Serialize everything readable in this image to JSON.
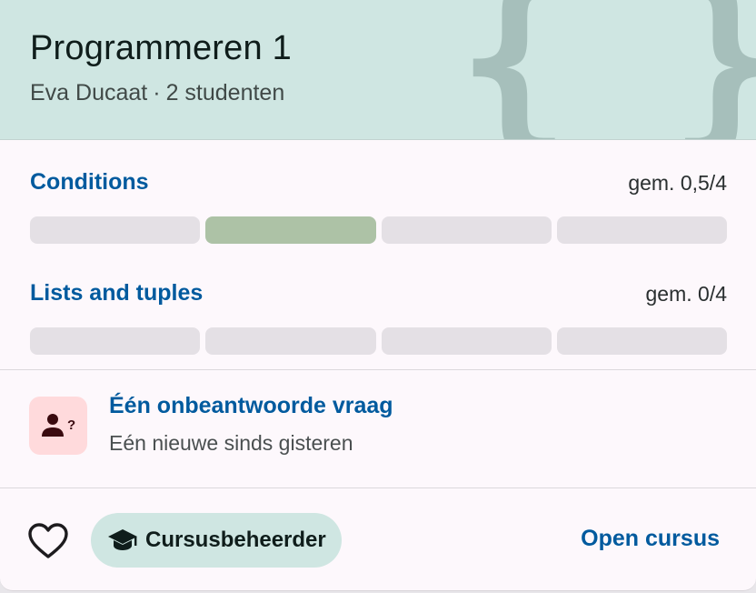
{
  "course": {
    "title": "Programmeren 1",
    "teacher": "Eva Ducaat",
    "separator": "·",
    "students": "2 studenten",
    "decoration": "{ }"
  },
  "exercises": [
    {
      "name": "Conditions",
      "score": "gem. 0,5/4",
      "bars": [
        {
          "state": "empty",
          "color": "#e4e0e5"
        },
        {
          "state": "partial",
          "color": "#adc2a6"
        },
        {
          "state": "empty",
          "color": "#e4e0e5"
        },
        {
          "state": "empty",
          "color": "#e4e0e5"
        }
      ]
    },
    {
      "name": "Lists and tuples",
      "score": "gem. 0/4",
      "bars": [
        {
          "state": "empty",
          "color": "#e4e0e5"
        },
        {
          "state": "empty",
          "color": "#e4e0e5"
        },
        {
          "state": "empty",
          "color": "#e4e0e5"
        },
        {
          "state": "empty",
          "color": "#e4e0e5"
        }
      ]
    }
  ],
  "questions": {
    "title": "Één onbeantwoorde vraag",
    "subtitle": "Eén nieuwe sinds gisteren",
    "icon": "person-question-icon"
  },
  "footer": {
    "favorite_icon": "heart-outline-icon",
    "role_icon": "graduation-cap-icon",
    "role_label": "Cursusbeheerder",
    "open_label": "Open cursus"
  },
  "colors": {
    "accent": "#005a9e",
    "header_bg": "#cfe6e2",
    "question_icon_bg": "#ffdadc",
    "bar_empty": "#e4e0e5",
    "bar_partial": "#adc2a6"
  }
}
